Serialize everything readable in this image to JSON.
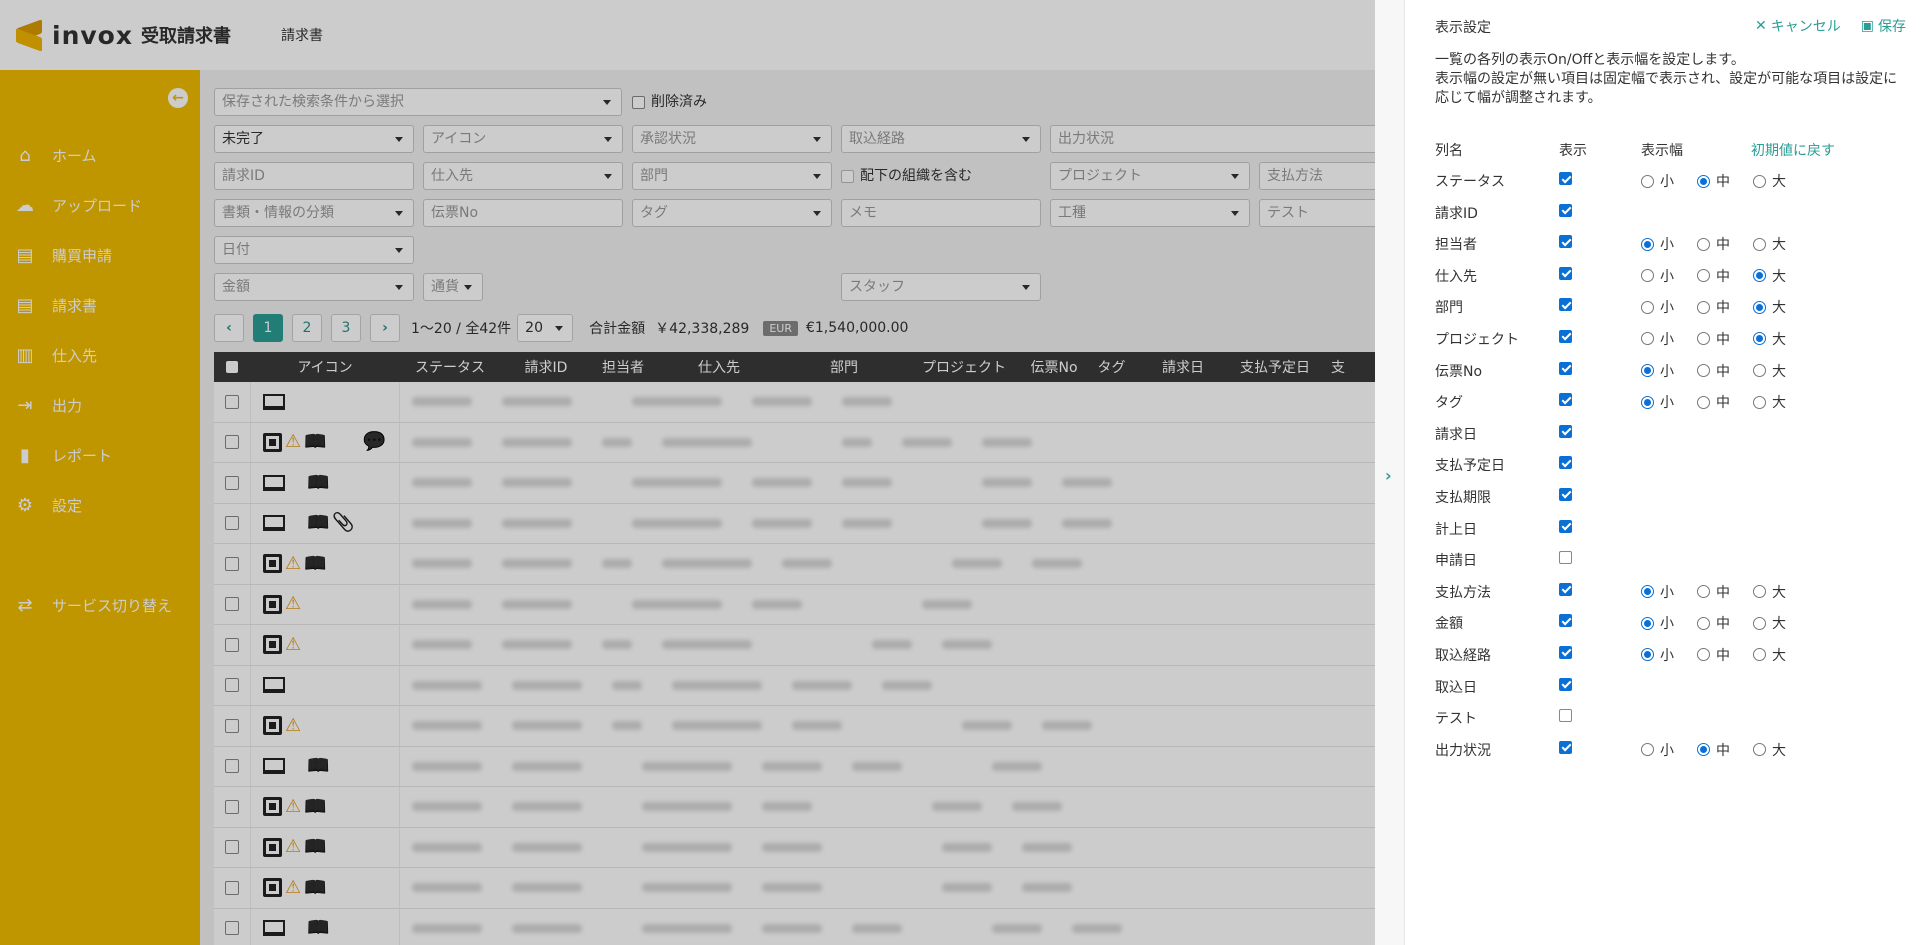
{
  "app": {
    "logo_text": "invox",
    "logo_sub": "受取請求書",
    "breadcrumb": "請求書"
  },
  "sidebar": {
    "items": [
      {
        "label": "ホーム",
        "icon": "home-icon"
      },
      {
        "label": "アップロード",
        "icon": "cloud-upload-icon"
      },
      {
        "label": "購買申請",
        "icon": "document-icon"
      },
      {
        "label": "請求書",
        "icon": "invoice-icon"
      },
      {
        "label": "仕入先",
        "icon": "building-icon"
      },
      {
        "label": "出力",
        "icon": "export-icon"
      },
      {
        "label": "レポート",
        "icon": "bar-chart-icon"
      },
      {
        "label": "設定",
        "icon": "gear-icon"
      },
      {
        "label": "サービス切り替え",
        "icon": "switch-icon"
      }
    ]
  },
  "filters": {
    "saved_search": "保存された検索条件から選択",
    "deleted_label": "削除済み",
    "status": "未完了",
    "icon": "アイコン",
    "approval": "承認状況",
    "import_route": "取込経路",
    "output_status": "出力状況",
    "invoice_id": "請求ID",
    "supplier": "仕入先",
    "department": "部門",
    "include_sub_org": "配下の組織を含む",
    "project": "プロジェクト",
    "payment_method": "支払方法",
    "doc_category": "書類・情報の分類",
    "voucher_no": "伝票No",
    "tag": "タグ",
    "memo": "メモ",
    "work_type": "工種",
    "test": "テスト",
    "date": "日付",
    "amount": "金額",
    "currency": "通貨",
    "staff": "スタッフ"
  },
  "pager": {
    "pages": [
      "1",
      "2",
      "3"
    ],
    "range_text": "1〜20 / 全42件",
    "per_page": "20",
    "total_label": "合計金額",
    "total_jpy": "￥42,338,289",
    "eur_badge": "EUR",
    "total_eur": "€1,540,000.00"
  },
  "table": {
    "headers": [
      "アイコン",
      "ステータス",
      "請求ID",
      "担当者",
      "仕入先",
      "部門",
      "プロジェクト",
      "伝票No",
      "タグ",
      "請求日",
      "支払予定日",
      "支"
    ]
  },
  "panel": {
    "title": "表示設定",
    "cancel_label": "キャンセル",
    "save_label": "保存",
    "description_1": "一覧の各列の表示On/Offと表示幅を設定します。",
    "description_2": "表示幅の設定が無い項目は固定幅で表示され、設定が可能な項目は設定に応じて幅が調整されます。",
    "col_name_header": "列名",
    "col_show_header": "表示",
    "col_width_header": "表示幅",
    "reset_label": "初期値に戻す",
    "width_small": "小",
    "width_medium": "中",
    "width_large": "大",
    "rows": [
      {
        "name": "ステータス",
        "show": true,
        "width": "中"
      },
      {
        "name": "請求ID",
        "show": true,
        "width": null
      },
      {
        "name": "担当者",
        "show": true,
        "width": "小"
      },
      {
        "name": "仕入先",
        "show": true,
        "width": "大"
      },
      {
        "name": "部門",
        "show": true,
        "width": "大"
      },
      {
        "name": "プロジェクト",
        "show": true,
        "width": "大"
      },
      {
        "name": "伝票No",
        "show": true,
        "width": "小"
      },
      {
        "name": "タグ",
        "show": true,
        "width": "小"
      },
      {
        "name": "請求日",
        "show": true,
        "width": null
      },
      {
        "name": "支払予定日",
        "show": true,
        "width": null
      },
      {
        "name": "支払期限",
        "show": true,
        "width": null
      },
      {
        "name": "計上日",
        "show": true,
        "width": null
      },
      {
        "name": "申請日",
        "show": false,
        "width": null
      },
      {
        "name": "支払方法",
        "show": true,
        "width": "小"
      },
      {
        "name": "金額",
        "show": true,
        "width": "小"
      },
      {
        "name": "取込経路",
        "show": true,
        "width": "小"
      },
      {
        "name": "取込日",
        "show": true,
        "width": null
      },
      {
        "name": "テスト",
        "show": false,
        "width": null
      },
      {
        "name": "出力状況",
        "show": true,
        "width": "中"
      }
    ]
  },
  "colors": {
    "sidebar": "#f0bc00",
    "accent": "#2a9d94",
    "checkbox": "#0a70d6"
  }
}
